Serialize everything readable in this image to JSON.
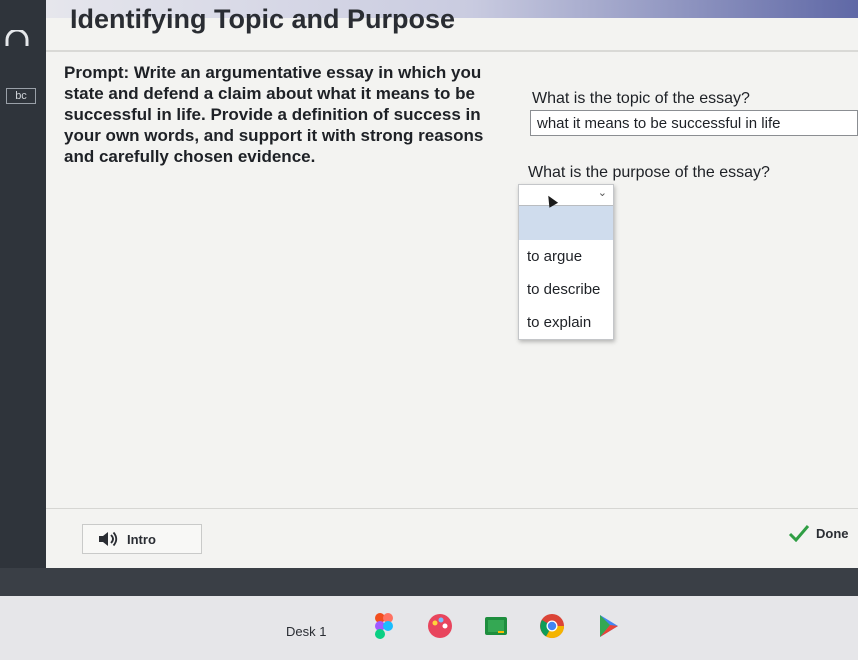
{
  "page": {
    "title": "Identifying Topic and Purpose",
    "prompt": "Prompt: Write an argumentative essay in which you state and defend a claim about what it means to be successful in life. Provide a definition of success in your own words, and support it with strong reasons and carefully chosen evidence."
  },
  "questions": {
    "topic": {
      "question": "What is the topic of the essay?",
      "answer": "what it means to be successful in life"
    },
    "purpose": {
      "question": "What is the purpose of the essay?",
      "options": [
        "to argue",
        "to describe",
        "to explain"
      ]
    }
  },
  "footer": {
    "intro_label": "Intro",
    "done_label": "Done"
  },
  "shelf": {
    "desk_label": "Desk 1",
    "apps": [
      "figma-icon",
      "paint-icon",
      "classroom-icon",
      "chrome-icon",
      "play-store-icon"
    ]
  },
  "edge": {
    "label": "bc"
  },
  "colors": {
    "highlight": "#cfdced",
    "check": "#2f9e44"
  }
}
